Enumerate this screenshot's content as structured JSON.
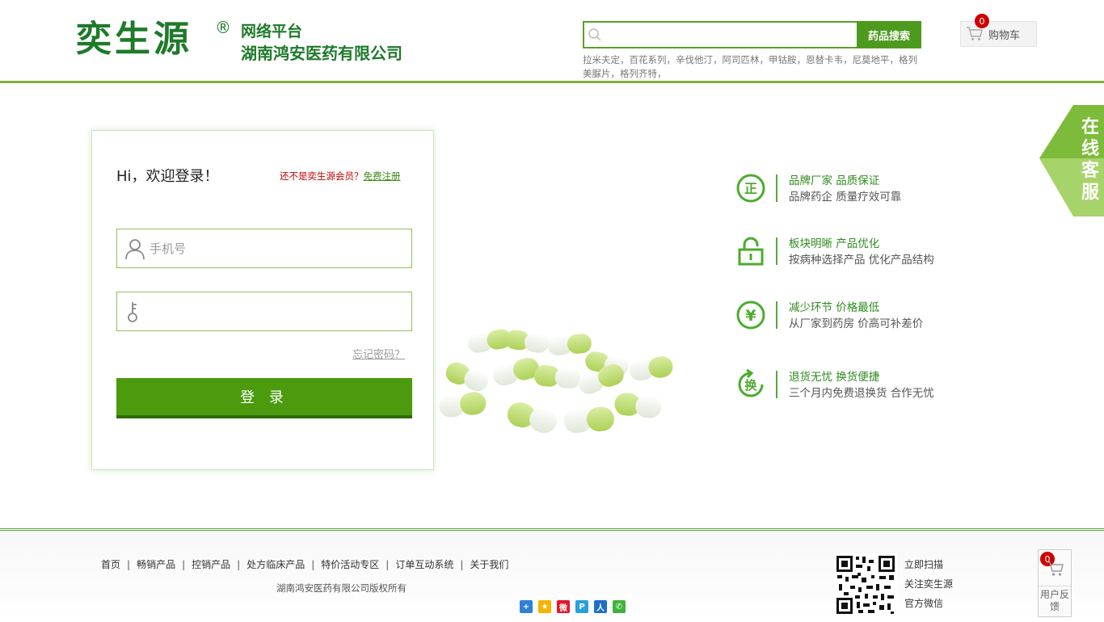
{
  "header": {
    "logo_main": "奕生源",
    "logo_reg": "®",
    "logo_sub1": "网络平台",
    "logo_sub2": "湖南鸿安医药有限公司",
    "search": {
      "placeholder": "",
      "button_label": "药品搜索",
      "icon": "search-icon"
    },
    "hot_keywords": "拉米夫定，百花系列，辛伐他汀，阿司匹林，甲钴胺，恩替卡韦，尼莫地平，格列美脲片，格列齐特，",
    "cart": {
      "label": "购物车",
      "count": "0",
      "icon": "cart-icon"
    }
  },
  "login": {
    "greeting": "Hi，欢迎登录！",
    "register_tip": "还不是奕生源会员？",
    "register_link": "免费注册",
    "phone_placeholder": "手机号",
    "password_placeholder": "",
    "forgot": "忘记密码？",
    "submit": "登 录"
  },
  "features": [
    {
      "icon": "certified-icon",
      "title": "品牌厂家 品质保证",
      "desc": "品牌药企 质量疗效可靠"
    },
    {
      "icon": "lock-icon",
      "title": "板块明晰 产品优化",
      "desc": "按病种选择产品 优化产品结构"
    },
    {
      "icon": "yuan-icon",
      "title": "减少环节 价格最低",
      "desc": "从厂家到药房 价高可补差价"
    },
    {
      "icon": "exchange-icon",
      "title": "退货无忧 换货便捷",
      "desc": "三个月内免费退换货 合作无忧"
    }
  ],
  "service": {
    "label": "在线客服"
  },
  "footer": {
    "nav": [
      "首页",
      "畅销产品",
      "控销产品",
      "处方临床产品",
      "特价活动专区",
      "订单互动系统",
      "关于我们"
    ],
    "copyright": "湖南鸿安医药有限公司版权所有",
    "share_icons": [
      "plus-share-icon",
      "qzone-icon",
      "weibo-icon",
      "tencent-weibo-icon",
      "renren-icon",
      "wechat-icon"
    ],
    "qr_lines": [
      "立即扫描",
      "关注奕生源",
      "官方微信"
    ],
    "feedback": {
      "count": "0",
      "label": "用户反馈"
    }
  },
  "colors": {
    "brand_green": "#1f7a2a",
    "accent_green": "#4c9a0d",
    "badge_red": "#cc0000"
  }
}
